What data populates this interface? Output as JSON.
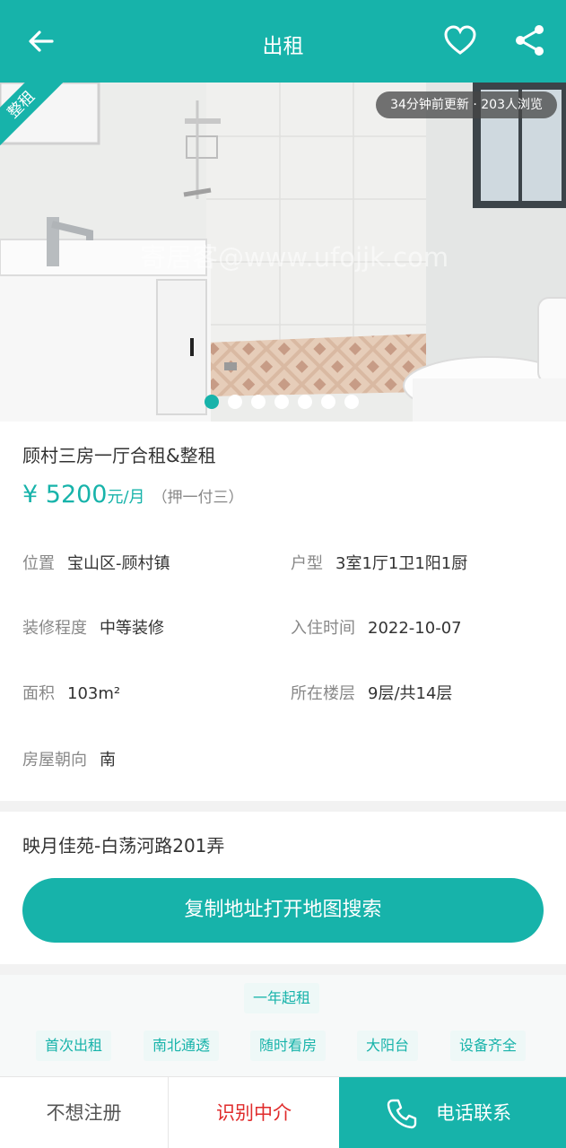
{
  "header": {
    "title": "出租",
    "back_icon": "arrow-left-icon",
    "favorite_icon": "heart-icon",
    "share_icon": "share-icon"
  },
  "gallery": {
    "ribbon": "整租",
    "views": "34分钟前更新 · 203人浏览",
    "watermark": "寄居客@www.ufojjk.com",
    "dot_count": 7,
    "active_dot": 0
  },
  "listing": {
    "name": "顾村三房一厅合租&整租",
    "price": "¥ 5200",
    "price_unit": "元/月",
    "deposit": "（押一付三）",
    "details": [
      {
        "key": "位置",
        "value": "宝山区-顾村镇"
      },
      {
        "key": "户型",
        "value": "3室1厅1卫1阳1厨"
      },
      {
        "key": "装修程度",
        "value": "中等装修"
      },
      {
        "key": "入住时间",
        "value": "2022-10-07"
      },
      {
        "key": "面积",
        "value": "103m²"
      },
      {
        "key": "所在楼层",
        "value": "9层/共14层"
      },
      {
        "key": "房屋朝向",
        "value": "南"
      }
    ]
  },
  "address": {
    "text": "映月佳苑-白荡河路201弄",
    "button": "复制地址打开地图搜索"
  },
  "tags": [
    "一年起租",
    "首次出租",
    "南北通透",
    "随时看房",
    "大阳台",
    "设备齐全"
  ],
  "bottom_bar": {
    "no_register": "不想注册",
    "identify_agent": "识别中介",
    "call": "电话联系",
    "call_icon": "phone-icon"
  },
  "colors": {
    "accent": "#17b3aa",
    "warning_text": "#e02b2b"
  }
}
